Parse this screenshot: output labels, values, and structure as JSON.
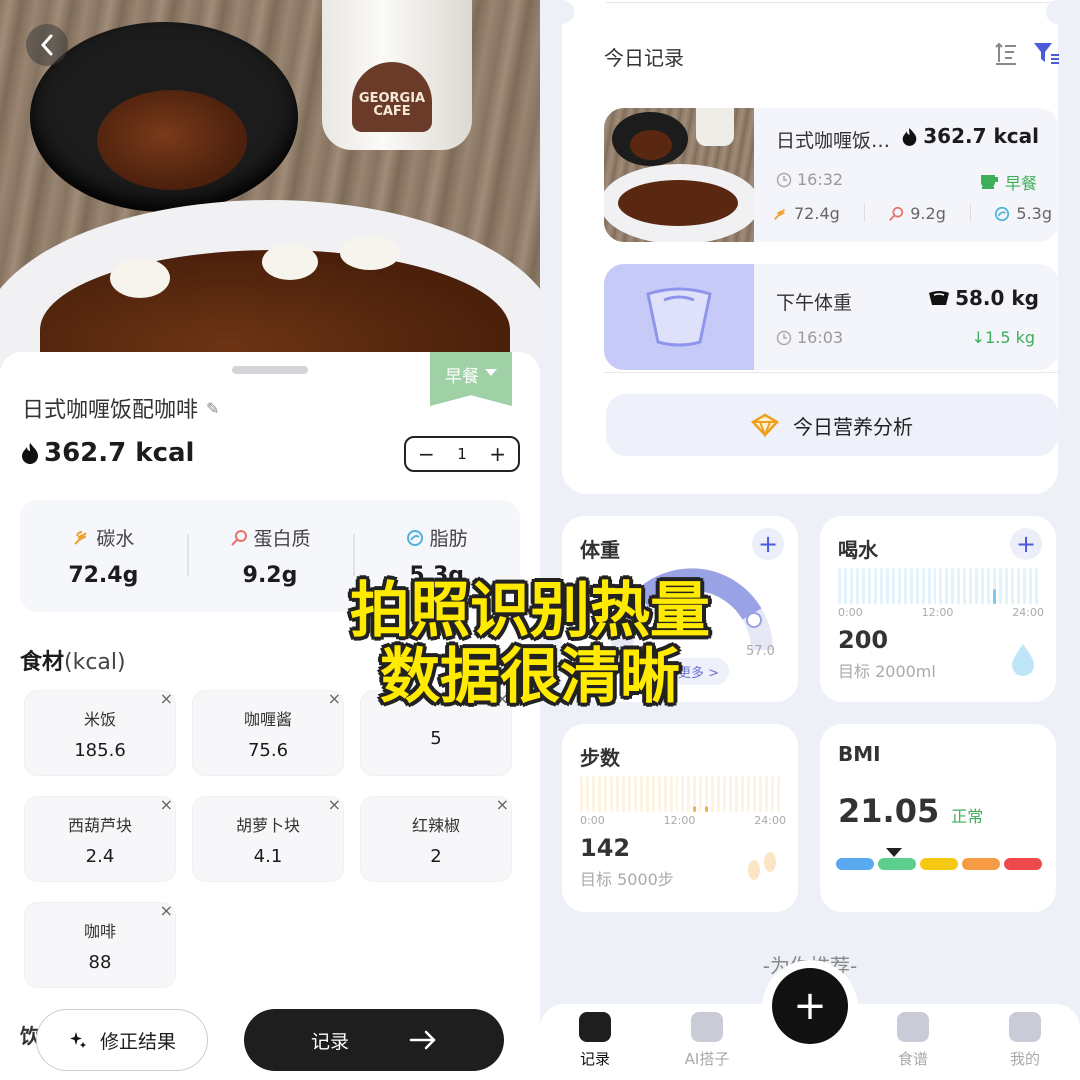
{
  "colors": {
    "accent_green": "#3fae5b",
    "accent_blue": "#4b5bd9",
    "overlay_yellow": "#ffea00",
    "meal_tag": "#9fd0a6"
  },
  "photo": {
    "cup_logo_text": "GEORGIA CAFE"
  },
  "left": {
    "meal_tag": "早餐",
    "dish_name": "日式咖喱饭配咖啡",
    "kcal": "362.7 kcal",
    "quantity": "1",
    "macros": [
      {
        "icon": "wheat-icon",
        "label": "碳水",
        "value": "72.4g"
      },
      {
        "icon": "drumstick-icon",
        "label": "蛋白质",
        "value": "9.2g"
      },
      {
        "icon": "fat-drop-icon",
        "label": "脂肪",
        "value": "5.3g"
      }
    ],
    "ingredients_title": "食材",
    "ingredients_unit": "(kcal)",
    "ingredients": [
      {
        "name": "米饭",
        "kcal": "185.6"
      },
      {
        "name": "咖喱酱",
        "kcal": "75.6"
      },
      {
        "name": "",
        "kcal": "5"
      },
      {
        "name": "西葫芦块",
        "kcal": "2.4"
      },
      {
        "name": "胡萝卜块",
        "kcal": "4.1"
      },
      {
        "name": "红辣椒",
        "kcal": "2"
      },
      {
        "name": "咖啡",
        "kcal": "88"
      }
    ],
    "drink_label": "饮",
    "fix_button": "修正结果",
    "record_button": "记录"
  },
  "right": {
    "today_title": "今日记录",
    "records": [
      {
        "name": "日式咖喱饭…",
        "kcal": "362.7 kcal",
        "time": "16:32",
        "meal": "早餐",
        "carb": "72.4g",
        "protein": "9.2g",
        "fat": "5.3g"
      },
      {
        "name": "下午体重",
        "value": "58.0 kg",
        "time": "16:03",
        "change": "↓1.5 kg"
      }
    ],
    "analysis_button": "今日营养分析",
    "weight": {
      "title": "体重",
      "tick": "57.0",
      "more": "更多 >"
    },
    "water": {
      "title": "喝水",
      "axis": [
        "0:00",
        "12:00",
        "24:00"
      ],
      "value": "200",
      "goal": "目标 2000ml"
    },
    "steps": {
      "title": "步数",
      "axis": [
        "0:00",
        "12:00",
        "24:00"
      ],
      "value": "142",
      "goal": "目标 5000步"
    },
    "bmi": {
      "title": "BMI",
      "value": "21.05",
      "status": "正常"
    },
    "recommend": "-为你推荐-",
    "tabs": [
      "记录",
      "AI搭子",
      "食谱",
      "我的"
    ]
  },
  "overlay": {
    "line1": "拍照识别热量",
    "line2": "数据很清晰"
  }
}
